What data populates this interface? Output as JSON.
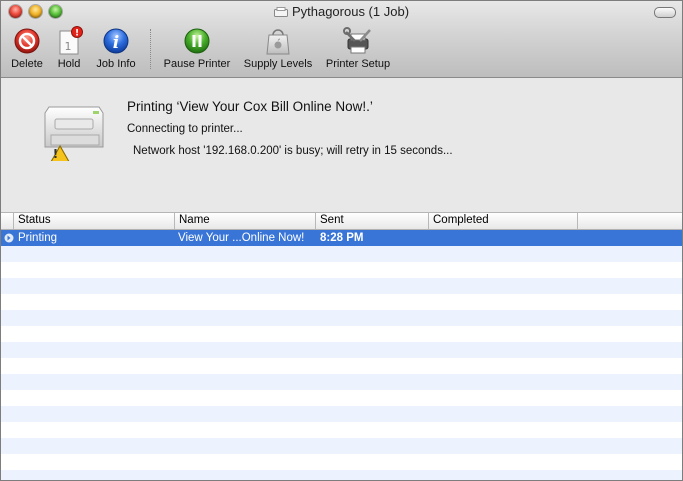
{
  "window": {
    "title": "Pythagorous (1 Job)"
  },
  "toolbar": {
    "delete_label": "Delete",
    "hold_label": "Hold",
    "job_info_label": "Job Info",
    "pause_printer_label": "Pause Printer",
    "supply_levels_label": "Supply Levels",
    "printer_setup_label": "Printer Setup"
  },
  "status": {
    "job_title": "Printing ‘View Your Cox Bill Online Now!.’",
    "subtitle": "Connecting to printer...",
    "message": "Network host '192.168.0.200' is busy; will retry in 15 seconds..."
  },
  "table": {
    "columns": [
      "Status",
      "Name",
      "Sent",
      "Completed"
    ],
    "rows": [
      {
        "status": "Printing",
        "name": "View Your ...Online Now!",
        "sent": "8:28 PM",
        "completed": ""
      }
    ]
  },
  "colors": {
    "selection": "#3875d7",
    "stripe": "#edf3fe"
  },
  "icons": [
    "delete-icon",
    "hold-icon",
    "job-info-icon",
    "pause-icon",
    "supply-levels-icon",
    "printer-setup-icon",
    "printer-icon",
    "warning-icon"
  ]
}
